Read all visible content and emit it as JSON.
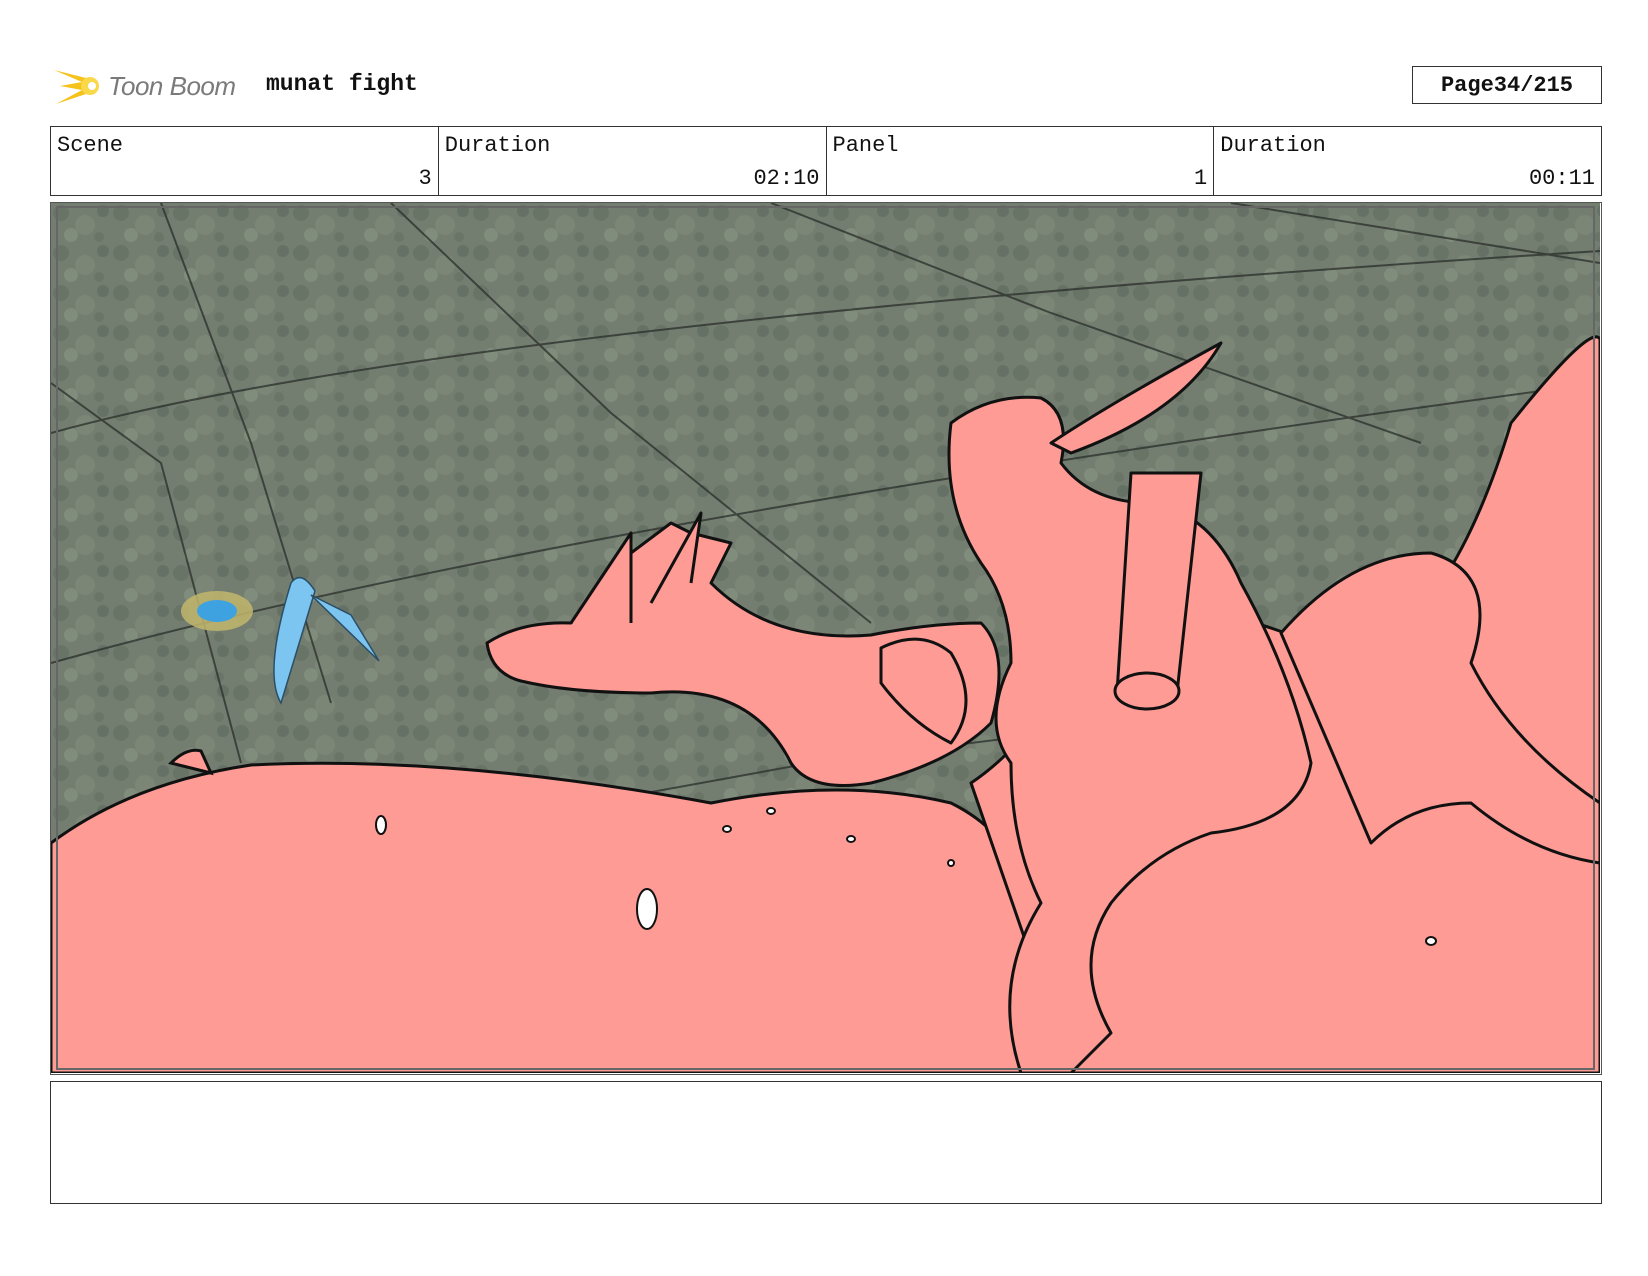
{
  "header": {
    "logo_text": "Toon Boom",
    "project_title": "munat fight",
    "page_label": "Page",
    "page_number": "34/215"
  },
  "info": {
    "scene_label": "Scene",
    "scene_value": "3",
    "scene_duration_label": "Duration",
    "scene_duration_value": "02:10",
    "panel_label": "Panel",
    "panel_value": "1",
    "panel_duration_label": "Duration",
    "panel_duration_value": "00:11"
  },
  "panel": {
    "colors": {
      "background": "#6b7668",
      "character_fill": "#fd9b94",
      "line": "#111111",
      "small_creature": "#7cc5f0",
      "glow": "#c2b66b"
    }
  },
  "caption": {
    "text": ""
  }
}
